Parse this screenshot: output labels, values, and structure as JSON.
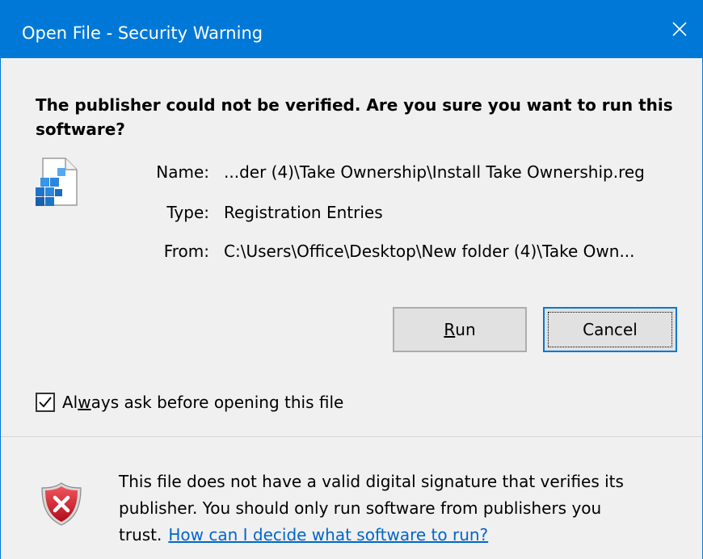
{
  "window": {
    "title": "Open File - Security Warning",
    "close_glyph": "✕"
  },
  "heading": "The publisher could not be verified.  Are you sure you want to run this software?",
  "file_icon": "registry-file-icon",
  "details": {
    "name_label": "Name:",
    "name_value": "...der (4)\\Take Ownership\\Install Take Ownership.reg",
    "type_label": "Type:",
    "type_value": "Registration Entries",
    "from_label": "From:",
    "from_value": "C:\\Users\\Office\\Desktop\\New folder (4)\\Take Own..."
  },
  "buttons": {
    "run_mnemonic": "R",
    "run_rest": "un",
    "cancel": "Cancel"
  },
  "checkbox": {
    "checked": true,
    "label_before": "Al",
    "label_mnemonic": "w",
    "label_after": "ays ask before opening this file"
  },
  "info": {
    "icon": "shield-error-icon",
    "text": "This file does not have a valid digital signature that verifies its publisher.  You should only run software from publishers you trust.",
    "link": "How can I decide what software to run?"
  },
  "colors": {
    "titlebar": "#0078d7",
    "background": "#f0f0f0",
    "link": "#0066cc",
    "shield": "#c8102e"
  }
}
